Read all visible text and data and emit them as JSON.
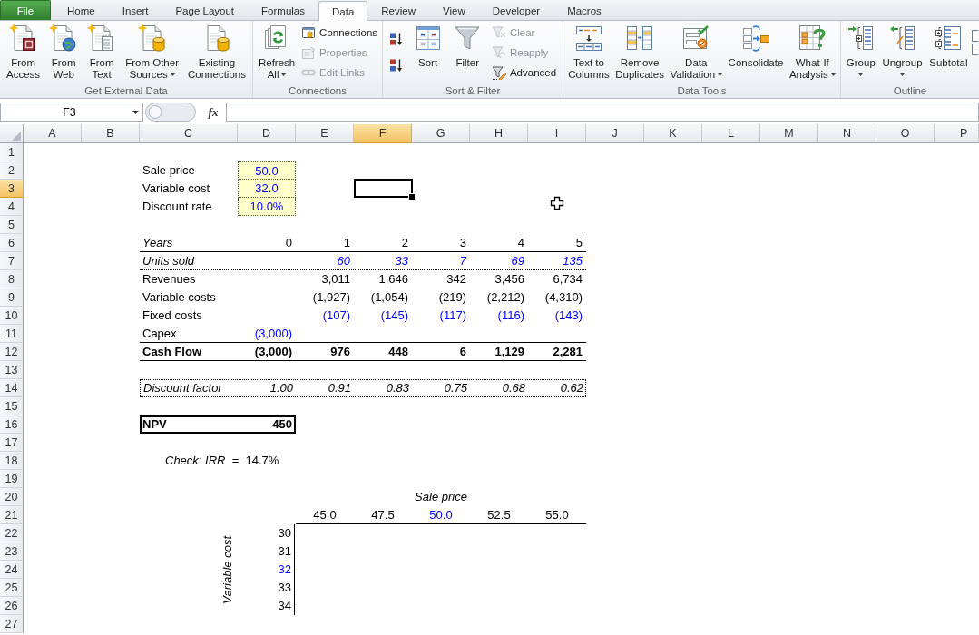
{
  "ribbon": {
    "tabs": [
      {
        "label": "File",
        "kind": "file",
        "selected": false
      },
      {
        "label": "Home",
        "kind": "tab",
        "selected": false
      },
      {
        "label": "Insert",
        "kind": "tab",
        "selected": false
      },
      {
        "label": "Page Layout",
        "kind": "tab",
        "selected": false
      },
      {
        "label": "Formulas",
        "kind": "tab",
        "selected": false
      },
      {
        "label": "Data",
        "kind": "tab",
        "selected": true
      },
      {
        "label": "Review",
        "kind": "tab",
        "selected": false
      },
      {
        "label": "View",
        "kind": "tab",
        "selected": false
      },
      {
        "label": "Developer",
        "kind": "tab",
        "selected": false
      },
      {
        "label": "Macros",
        "kind": "tab",
        "selected": false
      }
    ],
    "groups": [
      {
        "label": "Get External Data",
        "items": [
          {
            "kind": "large",
            "lines": [
              "From",
              "Access"
            ],
            "dropdown": false
          },
          {
            "kind": "large",
            "lines": [
              "From",
              "Web"
            ],
            "dropdown": false
          },
          {
            "kind": "large",
            "lines": [
              "From",
              "Text"
            ],
            "dropdown": false
          },
          {
            "kind": "large",
            "lines": [
              "From Other",
              "Sources"
            ],
            "dropdown": true
          },
          {
            "kind": "large",
            "lines": [
              "Existing",
              "Connections"
            ],
            "dropdown": false
          }
        ]
      },
      {
        "label": "Connections",
        "items": [
          {
            "kind": "large",
            "lines": [
              "Refresh",
              "All"
            ],
            "dropdown": true
          },
          {
            "kind": "stack",
            "buttons": [
              {
                "label": "Connections",
                "disabled": false
              },
              {
                "label": "Properties",
                "disabled": true
              },
              {
                "label": "Edit Links",
                "disabled": true
              }
            ]
          }
        ]
      },
      {
        "label": "Sort & Filter",
        "items": [
          {
            "kind": "icon-stack",
            "buttons": [
              {
                "disabled": false
              },
              {
                "disabled": false
              }
            ]
          },
          {
            "kind": "large",
            "lines": [
              "Sort"
            ],
            "dropdown": false
          },
          {
            "kind": "large",
            "lines": [
              "Filter"
            ],
            "dropdown": false
          },
          {
            "kind": "stack",
            "buttons": [
              {
                "label": "Clear",
                "disabled": true
              },
              {
                "label": "Reapply",
                "disabled": true
              },
              {
                "label": "Advanced",
                "disabled": false
              }
            ]
          }
        ]
      },
      {
        "label": "Data Tools",
        "items": [
          {
            "kind": "large",
            "lines": [
              "Text to",
              "Columns"
            ],
            "dropdown": false
          },
          {
            "kind": "large",
            "lines": [
              "Remove",
              "Duplicates"
            ],
            "dropdown": false
          },
          {
            "kind": "large",
            "lines": [
              "Data",
              "Validation"
            ],
            "dropdown": true
          },
          {
            "kind": "large",
            "lines": [
              "Consolidate"
            ],
            "dropdown": false
          },
          {
            "kind": "large",
            "lines": [
              "What-If",
              "Analysis"
            ],
            "dropdown": true
          }
        ]
      },
      {
        "label": "Outline",
        "items": [
          {
            "kind": "large",
            "lines": [
              "Group"
            ],
            "dropdown": true
          },
          {
            "kind": "large",
            "lines": [
              "Ungroup"
            ],
            "dropdown": true
          },
          {
            "kind": "large",
            "lines": [
              "Subtotal"
            ],
            "dropdown": false
          }
        ]
      }
    ]
  },
  "formula_bar": {
    "name_box": "F3",
    "function_button": "fx"
  },
  "sheet": {
    "columns": [
      {
        "label": "A",
        "selected": false
      },
      {
        "label": "B",
        "selected": false
      },
      {
        "label": "C",
        "selected": false
      },
      {
        "label": "D",
        "selected": false
      },
      {
        "label": "E",
        "selected": false
      },
      {
        "label": "F",
        "selected": true
      },
      {
        "label": "G",
        "selected": false
      },
      {
        "label": "H",
        "selected": false
      },
      {
        "label": "I",
        "selected": false
      },
      {
        "label": "J",
        "selected": false
      },
      {
        "label": "K",
        "selected": false
      },
      {
        "label": "L",
        "selected": false
      },
      {
        "label": "M",
        "selected": false
      },
      {
        "label": "N",
        "selected": false
      },
      {
        "label": "O",
        "selected": false
      },
      {
        "label": "P",
        "selected": false
      }
    ],
    "rows": [
      {
        "label": "1",
        "selected": false
      },
      {
        "label": "2",
        "selected": false
      },
      {
        "label": "3",
        "selected": true
      },
      {
        "label": "4",
        "selected": false
      },
      {
        "label": "5",
        "selected": false
      },
      {
        "label": "6",
        "selected": false
      },
      {
        "label": "7",
        "selected": false
      },
      {
        "label": "8",
        "selected": false
      },
      {
        "label": "9",
        "selected": false
      },
      {
        "label": "10",
        "selected": false
      },
      {
        "label": "11",
        "selected": false
      },
      {
        "label": "12",
        "selected": false
      },
      {
        "label": "13",
        "selected": false
      },
      {
        "label": "14",
        "selected": false
      },
      {
        "label": "15",
        "selected": false
      },
      {
        "label": "16",
        "selected": false
      },
      {
        "label": "17",
        "selected": false
      },
      {
        "label": "18",
        "selected": false
      },
      {
        "label": "19",
        "selected": false
      },
      {
        "label": "20",
        "selected": false
      },
      {
        "label": "21",
        "selected": false
      },
      {
        "label": "22",
        "selected": false
      },
      {
        "label": "23",
        "selected": false
      },
      {
        "label": "24",
        "selected": false
      },
      {
        "label": "25",
        "selected": false
      },
      {
        "label": "26",
        "selected": false
      },
      {
        "label": "27",
        "selected": false
      }
    ],
    "inputs": [
      {
        "label": "Sale price",
        "value": "50.0"
      },
      {
        "label": "Variable cost",
        "value": "32.0"
      },
      {
        "label": "Discount rate",
        "value": "10.0%"
      }
    ],
    "cash_flow": [
      {
        "kind": "years",
        "label": "Years",
        "initial": "0",
        "annual": [
          "1",
          "2",
          "3",
          "4",
          "5"
        ],
        "ruled": true
      },
      {
        "kind": "driver",
        "label": "Units sold",
        "annual": [
          "60",
          "33",
          "7",
          "69",
          "135"
        ],
        "ruled": true
      },
      {
        "kind": "line",
        "label": "Revenues",
        "annual": [
          "3,011",
          "1,646",
          "342",
          "3,456",
          "6,734"
        ],
        "ruled": false
      },
      {
        "kind": "line",
        "label": "Variable costs",
        "annual": [
          "(1,927)",
          "(1,054)",
          "(219)",
          "(2,212)",
          "(4,310)"
        ],
        "ruled": false
      },
      {
        "kind": "assumption",
        "label": "Fixed costs",
        "annual": [
          "(107)",
          "(145)",
          "(117)",
          "(116)",
          "(143)"
        ],
        "ruled": false
      },
      {
        "kind": "assumption",
        "label": "Capex",
        "initial": "(3,000)",
        "ruled": true
      },
      {
        "kind": "total",
        "label": "Cash Flow",
        "initial": "(3,000)",
        "annual": [
          "976",
          "448",
          "6",
          "1,129",
          "2,281"
        ],
        "ruled": true
      }
    ],
    "discount_factor": {
      "label": "Discount factor",
      "initial": "1.00",
      "annual": [
        "0.91",
        "0.83",
        "0.75",
        "0.68",
        "0.62"
      ]
    },
    "npv": {
      "label": "NPV",
      "value": "450"
    },
    "irr_check": "*Check: IRR*  =  14.7%",
    "data_table": {
      "column_title": "Sale price",
      "column_inputs": [
        {
          "label": "45.0",
          "color": "#000000"
        },
        {
          "label": "47.5",
          "color": "#000000"
        },
        {
          "label": "50.0",
          "color": "#0000ff"
        },
        {
          "label": "52.5",
          "color": "#000000"
        },
        {
          "label": "55.0",
          "color": "#000000"
        }
      ],
      "row_title": "Variable cost",
      "row_inputs": [
        {
          "label": "30",
          "color": "#000000"
        },
        {
          "label": "31",
          "color": "#000000"
        },
        {
          "label": "32",
          "color": "#0000ff"
        },
        {
          "label": "33",
          "color": "#000000"
        },
        {
          "label": "34",
          "color": "#000000"
        }
      ]
    }
  }
}
